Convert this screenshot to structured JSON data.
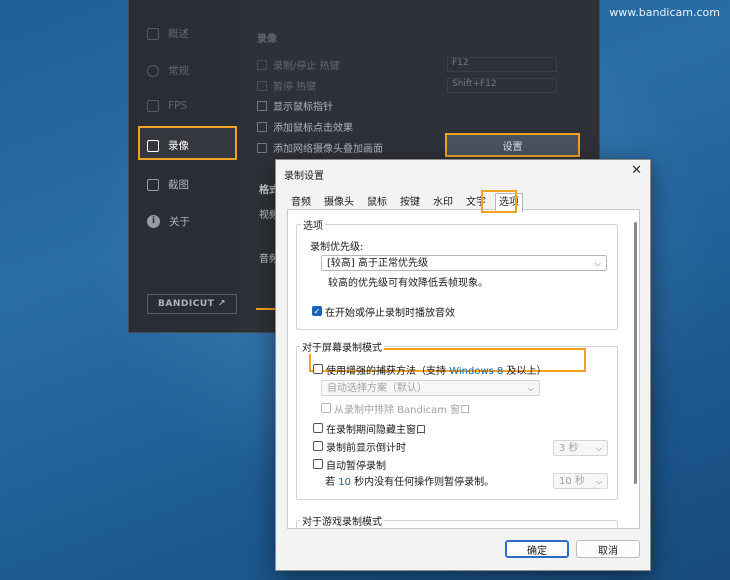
{
  "watermark": "www.bandicam.com",
  "background_window": {
    "sidebar": {
      "items": [
        {
          "label": "概述",
          "icon": "home-icon",
          "dim": true
        },
        {
          "label": "常规",
          "icon": "gear-icon",
          "dim": true
        },
        {
          "label": "FPS",
          "icon": "fps-icon",
          "dim": true
        },
        {
          "label": "录像",
          "icon": "video-record-icon",
          "dim": false,
          "highlighted": true
        },
        {
          "label": "截图",
          "icon": "image-icon",
          "dim": false
        },
        {
          "label": "关于",
          "icon": "info-icon",
          "dim": false
        }
      ],
      "bandicut_label": "BANDICUT ↗"
    },
    "section_title": "录像",
    "rows": [
      {
        "label": "录制/停止 热键",
        "value": "F12"
      },
      {
        "label": "暂停 热键",
        "value": "Shift+F12"
      },
      {
        "label": "显示鼠标指针"
      },
      {
        "label": "添加鼠标点击效果"
      },
      {
        "label": "添加网络摄像头叠加画面"
      }
    ],
    "settings_button": "设置",
    "format_label": "格式",
    "video_label": "视频",
    "audio_label": "音频"
  },
  "dialog": {
    "title": "录制设置",
    "close_glyph": "✕",
    "tabs": [
      "音频",
      "摄像头",
      "鼠标",
      "按键",
      "水印",
      "文字",
      "选项"
    ],
    "active_tab": "选项",
    "options_group": {
      "title": "选项",
      "priority_label": "录制优先级:",
      "priority_value": "[较高] 高于正常优先级",
      "priority_hint": "较高的优先级可有效降低丢帧现象。",
      "play_sound_label": "在开始或停止录制时播放音效",
      "play_sound_checked": true
    },
    "screen_group": {
      "title": "对于屏幕录制模式",
      "enhanced_capture_prefix": "使用增强的捕获方法（支持 ",
      "enhanced_capture_win": "Windows 8",
      "enhanced_capture_suffix": " 及以上）",
      "auto_select_value": "自动选择方案（默认）",
      "exclude_window_label": "从录制中排除 Bandicam 窗口",
      "hide_main_label": "在录制期间隐藏主窗口",
      "countdown_label": "录制前显示倒计时",
      "countdown_value": "3 秒",
      "auto_pause_label": "自动暂停录制",
      "auto_pause_hint_prefix": "若 ",
      "auto_pause_hint_num": "10",
      "auto_pause_hint_suffix": " 秒内没有任何操作则暂停录制。",
      "auto_pause_value": "10 秒"
    },
    "game_group": {
      "title": "对于游戏录制模式"
    },
    "ok_button": "确定",
    "cancel_button": "取消"
  },
  "accent_color": "#f2a324",
  "checkbox_color": "#1a64b8"
}
